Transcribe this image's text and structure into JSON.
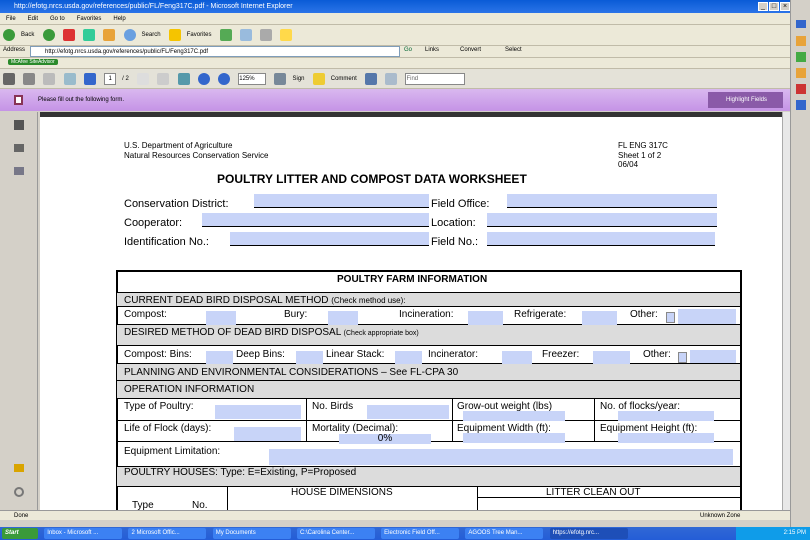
{
  "window": {
    "title": "http://efotg.nrcs.usda.gov/references/public/FL/Feng317C.pdf - Microsoft Internet Explorer"
  },
  "menu": [
    "File",
    "Edit",
    "Go to",
    "Favorites",
    "Help"
  ],
  "toolbar": {
    "back": "Back",
    "search": "Search",
    "favorites": "Favorites"
  },
  "address": {
    "label": "Address",
    "url": "http://efotg.nrcs.usda.gov/references/public/FL/Feng317C.pdf",
    "go": "Go",
    "links": "Links",
    "convert": "Convert",
    "select": "Select"
  },
  "links_bar": {
    "item": "McAfee SiteAdvisor"
  },
  "acrobat": {
    "page_current": "1",
    "page_total": "/ 2",
    "zoom": "125%",
    "sign": "Sign",
    "comment": "Comment",
    "find_placeholder": "Find"
  },
  "notice": {
    "text": "Please fill out the following form.",
    "highlight": "Highlight Fields"
  },
  "form": {
    "agency1": "U.S. Department of Agriculture",
    "agency2": "Natural Resources Conservation Service",
    "code": "FL ENG 317C",
    "sheet": "Sheet 1 of 2",
    "date": "06/04",
    "title": "POULTRY LITTER AND COMPOST DATA WORKSHEET",
    "conservation_district": "Conservation District:",
    "field_office": "Field Office:",
    "cooperator": "Cooperator:",
    "location": "Location:",
    "identification": "Identification No.:",
    "field_no": "Field No.:",
    "farm_info": "POULTRY FARM INFORMATION",
    "current_method": "CURRENT DEAD BIRD DISPOSAL METHOD",
    "current_note": "(Check method use):",
    "current_opts": [
      "Compost:",
      "Bury:",
      "Incineration:",
      "Refrigerate:",
      "Other:"
    ],
    "desired_method": "DESIRED METHOD OF DEAD BIRD DISPOSAL",
    "desired_note": "(Check appropriate box)",
    "desired_opts": [
      "Compost: Bins:",
      "Deep Bins:",
      "Linear Stack:",
      "Incinerator:",
      "Freezer:",
      "Other:"
    ],
    "planning": "PLANNING AND ENVIRONMENTAL CONSIDERATIONS – See FL-CPA 30",
    "operation": "OPERATION INFORMATION",
    "type_poultry": "Type of Poultry:",
    "no_birds": "No. Birds",
    "growout": "Grow-out weight (lbs)",
    "flocks": "No. of flocks/year:",
    "life_flock": "Life of Flock (days):",
    "mortality": "Mortality  (Decimal):",
    "mortality_value": "0%",
    "eq_width": "Equipment Width (ft):",
    "eq_height": "Equipment Height (ft):",
    "eq_limit": "Equipment Limitation:",
    "houses": "POULTRY HOUSES: Type: E=Existing, P=Proposed",
    "house_dim": "HOUSE DIMENSIONS",
    "litter": "LITTER CLEAN OUT",
    "type": "Type",
    "no": "No."
  },
  "status": {
    "text": "Done",
    "zone": "Unknown Zone"
  },
  "taskbar": {
    "start": "Start",
    "items": [
      "Inbox - Microsoft ...",
      "2 Microsoft Offic...",
      "My Documents",
      "C:\\Carolina Center...",
      "Electronic Field Off...",
      "AGOOS Tree Man...",
      "https://efotg.nrc..."
    ],
    "clock": "2:15 PM"
  }
}
